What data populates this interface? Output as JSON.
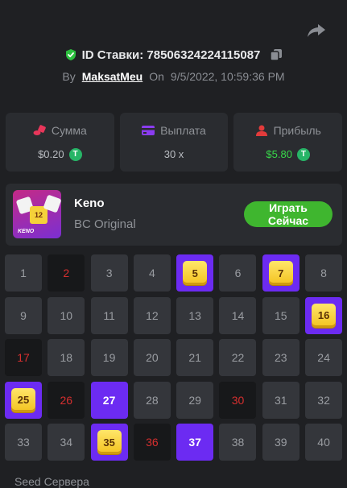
{
  "header": {
    "bet_id": "ID Ставки: 78506324224115087",
    "by_label": "By",
    "user": "MaksatMeu",
    "on_label": "On",
    "datetime": "9/5/2022, 10:59:36 PM"
  },
  "stats": [
    {
      "label": "Сумма",
      "value": "$0.20",
      "coin": "T"
    },
    {
      "label": "Выплата",
      "value": "30 x"
    },
    {
      "label": "Прибыль",
      "value": "$5.80",
      "coin": "T"
    }
  ],
  "game": {
    "name": "Keno",
    "subtitle": "BC Original",
    "thumb_label": "KENO",
    "thumb_tile": "12",
    "play_button": "Играть Сейчас"
  },
  "grid": {
    "cells": [
      {
        "n": "1",
        "state": "normal"
      },
      {
        "n": "2",
        "state": "miss"
      },
      {
        "n": "3",
        "state": "normal"
      },
      {
        "n": "4",
        "state": "normal"
      },
      {
        "n": "5",
        "state": "hit"
      },
      {
        "n": "6",
        "state": "normal"
      },
      {
        "n": "7",
        "state": "hit"
      },
      {
        "n": "8",
        "state": "normal"
      },
      {
        "n": "9",
        "state": "normal"
      },
      {
        "n": "10",
        "state": "normal"
      },
      {
        "n": "11",
        "state": "normal"
      },
      {
        "n": "12",
        "state": "normal"
      },
      {
        "n": "13",
        "state": "normal"
      },
      {
        "n": "14",
        "state": "normal"
      },
      {
        "n": "15",
        "state": "normal"
      },
      {
        "n": "16",
        "state": "hit"
      },
      {
        "n": "17",
        "state": "miss"
      },
      {
        "n": "18",
        "state": "normal"
      },
      {
        "n": "19",
        "state": "normal"
      },
      {
        "n": "20",
        "state": "normal"
      },
      {
        "n": "21",
        "state": "normal"
      },
      {
        "n": "22",
        "state": "normal"
      },
      {
        "n": "23",
        "state": "normal"
      },
      {
        "n": "24",
        "state": "normal"
      },
      {
        "n": "25",
        "state": "hit"
      },
      {
        "n": "26",
        "state": "miss"
      },
      {
        "n": "27",
        "state": "pick"
      },
      {
        "n": "28",
        "state": "normal"
      },
      {
        "n": "29",
        "state": "normal"
      },
      {
        "n": "30",
        "state": "miss"
      },
      {
        "n": "31",
        "state": "normal"
      },
      {
        "n": "32",
        "state": "normal"
      },
      {
        "n": "33",
        "state": "normal"
      },
      {
        "n": "34",
        "state": "normal"
      },
      {
        "n": "35",
        "state": "hit"
      },
      {
        "n": "36",
        "state": "miss"
      },
      {
        "n": "37",
        "state": "pick"
      },
      {
        "n": "38",
        "state": "normal"
      },
      {
        "n": "39",
        "state": "normal"
      },
      {
        "n": "40",
        "state": "normal"
      }
    ]
  },
  "footer": {
    "seed_label": "Seed Сервера"
  },
  "colors": {
    "background": "#1f2023",
    "card": "#2a2c30",
    "accent_purple": "#6c2bf2",
    "play_green": "#3fb62f",
    "miss_red": "#d62f2f",
    "profit_green": "#38d94a"
  },
  "icons": {
    "share": "share-icon",
    "verified": "shield-check-icon",
    "copy": "copy-icon",
    "amount": "coins-icon",
    "payout": "wallet-icon",
    "profit": "profit-user-icon",
    "coin": "tether-coin-icon"
  }
}
